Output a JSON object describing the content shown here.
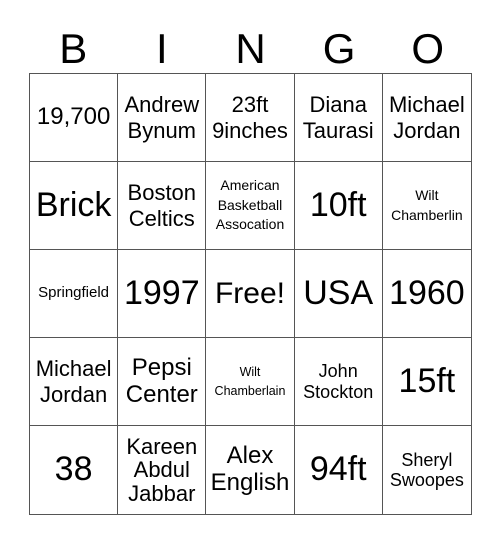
{
  "header": {
    "letters": [
      "B",
      "I",
      "N",
      "G",
      "O"
    ]
  },
  "board": {
    "cells": [
      "19,700",
      "Andrew\nBynum",
      "23ft\n9inches",
      "Diana\nTaurasi",
      "Michael\nJordan",
      "Brick",
      "Boston\nCeltics",
      "American\nBasketball\nAssocation",
      "10ft",
      "Wilt\nChamberlin",
      "Springfield",
      "1997",
      "Free!",
      "USA",
      "1960",
      "Michael\nJordan",
      "Pepsi\nCenter",
      "Wilt\nChamberlain",
      "John\nStockton",
      "15ft",
      "38",
      "Kareen\nAbdul\nJabbar",
      "Alex\nEnglish",
      "94ft",
      "Sheryl\nSwoopes"
    ]
  }
}
